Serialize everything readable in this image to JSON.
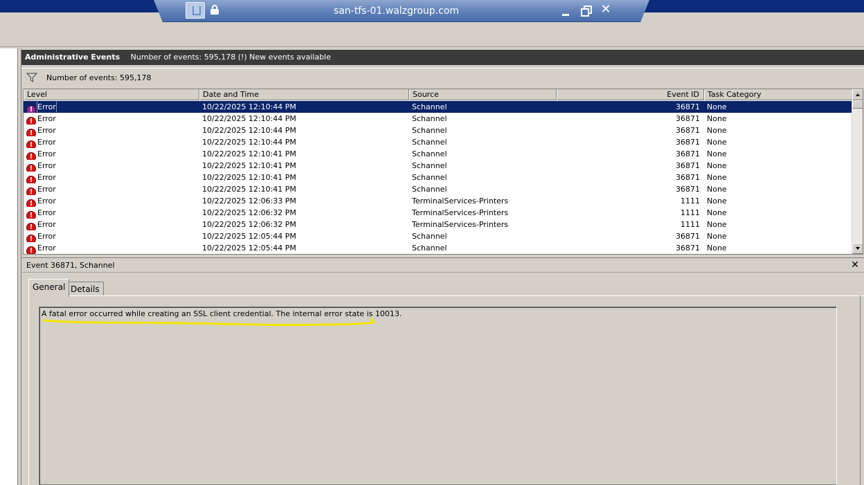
{
  "window": {
    "title": "san-tfs-01.walzgroup.com"
  },
  "header": {
    "title": "Administrative Events",
    "info": "Number of events: 595,178 (!) New events available"
  },
  "filter": {
    "label": "Number of events: 595,178"
  },
  "columns": [
    "Level",
    "Date and Time",
    "Source",
    "Event ID",
    "Task Category"
  ],
  "events": [
    {
      "level": "Error",
      "datetime": "10/22/2025 12:10:44 PM",
      "source": "Schannel",
      "event_id": "36871",
      "task": "None",
      "selected": true
    },
    {
      "level": "Error",
      "datetime": "10/22/2025 12:10:44 PM",
      "source": "Schannel",
      "event_id": "36871",
      "task": "None"
    },
    {
      "level": "Error",
      "datetime": "10/22/2025 12:10:44 PM",
      "source": "Schannel",
      "event_id": "36871",
      "task": "None"
    },
    {
      "level": "Error",
      "datetime": "10/22/2025 12:10:44 PM",
      "source": "Schannel",
      "event_id": "36871",
      "task": "None"
    },
    {
      "level": "Error",
      "datetime": "10/22/2025 12:10:41 PM",
      "source": "Schannel",
      "event_id": "36871",
      "task": "None"
    },
    {
      "level": "Error",
      "datetime": "10/22/2025 12:10:41 PM",
      "source": "Schannel",
      "event_id": "36871",
      "task": "None"
    },
    {
      "level": "Error",
      "datetime": "10/22/2025 12:10:41 PM",
      "source": "Schannel",
      "event_id": "36871",
      "task": "None"
    },
    {
      "level": "Error",
      "datetime": "10/22/2025 12:10:41 PM",
      "source": "Schannel",
      "event_id": "36871",
      "task": "None"
    },
    {
      "level": "Error",
      "datetime": "10/22/2025 12:06:33 PM",
      "source": "TerminalServices-Printers",
      "event_id": "1111",
      "task": "None"
    },
    {
      "level": "Error",
      "datetime": "10/22/2025 12:06:32 PM",
      "source": "TerminalServices-Printers",
      "event_id": "1111",
      "task": "None"
    },
    {
      "level": "Error",
      "datetime": "10/22/2025 12:06:32 PM",
      "source": "TerminalServices-Printers",
      "event_id": "1111",
      "task": "None"
    },
    {
      "level": "Error",
      "datetime": "10/22/2025 12:05:44 PM",
      "source": "Schannel",
      "event_id": "36871",
      "task": "None"
    },
    {
      "level": "Error",
      "datetime": "10/22/2025 12:05:44 PM",
      "source": "Schannel",
      "event_id": "36871",
      "task": "None"
    }
  ],
  "detail": {
    "title": "Event 36871, Schannel",
    "tabs": [
      "General",
      "Details"
    ],
    "message": "A fatal error occurred while creating an SSL client credential. The internal error state is 10013."
  },
  "icons": {
    "level": "error-icon",
    "filter": "filter-icon",
    "lock": "lock-icon",
    "pin": "pin-icon"
  },
  "colors": {
    "selection": "#0a246a",
    "error": "#d41414",
    "highlight_annotation": "#f5e600",
    "rdp_bar": "#5f80b8"
  }
}
